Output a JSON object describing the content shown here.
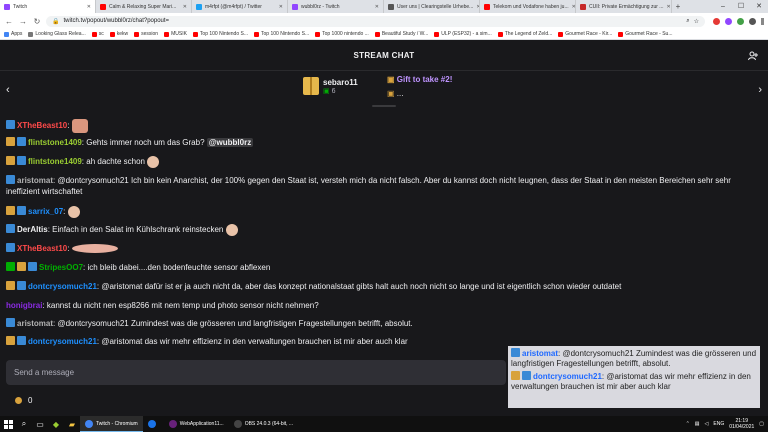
{
  "browser": {
    "tabs": [
      {
        "title": "Twitch",
        "color": "#9146ff",
        "active": true
      },
      {
        "title": "Calm & Relaxing Super Mari...",
        "color": "#ff0000"
      },
      {
        "title": "m4rfpt (@m4rfpt) / Twitter",
        "color": "#1da1f2"
      },
      {
        "title": "wubbl0rz - Twitch",
        "color": "#9146ff"
      },
      {
        "title": "User uns | Clearingstelle Urhebe...",
        "color": "#555555"
      },
      {
        "title": "Telekom und Vodafone haben ju...",
        "color": "#ff0000"
      },
      {
        "title": "CUII: Private Ermächtigung zur ...",
        "color": "#c62828"
      }
    ],
    "url": "twitch.tv/popout/wubbl0rz/chat?popout=",
    "bookmarks": [
      {
        "label": "Apps",
        "color": "#4285f4"
      },
      {
        "label": "Looking Glass Relea...",
        "color": "#777777"
      },
      {
        "label": "sc",
        "color": "#ff0000"
      },
      {
        "label": "kekw",
        "color": "#ff0000"
      },
      {
        "label": "session",
        "color": "#ff0000"
      },
      {
        "label": "MUSIK",
        "color": "#ff0000"
      },
      {
        "label": "Top 100 Nintendo S...",
        "color": "#ff0000"
      },
      {
        "label": "Top 100 Nintendo S...",
        "color": "#ff0000"
      },
      {
        "label": "Top 1000 nintendo ...",
        "color": "#ff0000"
      },
      {
        "label": "Beautiful Study / W...",
        "color": "#ff0000"
      },
      {
        "label": "ULP (ESP32) - a sim...",
        "color": "#ff0000"
      },
      {
        "label": "The Legend of Zeld...",
        "color": "#ff0000"
      },
      {
        "label": "Gourmet Race - Kir...",
        "color": "#ff0000"
      },
      {
        "label": "Gourmet Race - Su...",
        "color": "#ff0000"
      }
    ]
  },
  "chat": {
    "header_title": "STREAM CHAT",
    "gifter": {
      "name": "sebaro11",
      "count": "6"
    },
    "gift_cta": "Gift to take #2!",
    "gift_cta_sub": "...",
    "messages": [
      {
        "badges": [
          "sub"
        ],
        "name": "XTheBeast10",
        "color": "#ff4a4a",
        "text": "",
        "emote": "wide"
      },
      {
        "badges": [
          "gift",
          "sub"
        ],
        "name": "flintstone1409",
        "color": "#9acd32",
        "text": "Gehts immer noch um das Grab? ",
        "mention": "@wubbl0rz"
      },
      {
        "badges": [
          "gift",
          "sub"
        ],
        "name": "flintstone1409",
        "color": "#9acd32",
        "text": "ah dachte schon ",
        "emote": "small"
      },
      {
        "badges": [
          "sub"
        ],
        "name": "aristomat",
        "color": "#b3b3b3",
        "text": "@dontcrysomuch21 Ich bin kein Anarchist, der 100% gegen den Staat ist, versteh mich da nicht falsch. Aber du kannst doch nicht leugnen, dass der Staat in den meisten Bereichen sehr sehr ineffizient wirtschaftet"
      },
      {
        "badges": [
          "gift",
          "sub"
        ],
        "name": "sarrix_07",
        "color": "#1e90ff",
        "text": "",
        "emote": "small"
      },
      {
        "badges": [
          "sub"
        ],
        "name": "DerAltis",
        "color": "#efeff1",
        "text": "Einfach in den Salat im Kühlschrank reinstecken ",
        "emote": "small"
      },
      {
        "badges": [
          "sub"
        ],
        "name": "XTheBeast10",
        "color": "#ff4a4a",
        "text": "",
        "emote": "long"
      },
      {
        "badges": [
          "mod",
          "gift",
          "sub"
        ],
        "name": "StripesOO7",
        "color": "#00b000",
        "text": "ich bleib dabei....den bodenfeuchte sensor abflexen"
      },
      {
        "badges": [
          "gift",
          "sub"
        ],
        "name": "dontcrysomuch21",
        "color": "#1e90ff",
        "text": "@aristomat dafür ist er ja auch nicht da, aber das konzept nationalstaat gibts halt auch noch nicht so lange und ist eigentlich schon wieder outdatet"
      },
      {
        "badges": [],
        "name": "honigbrai",
        "color": "#8a2be2",
        "text": "kannst du nicht nen esp8266 mit nem temp und photo sensor nicht nehmen?"
      },
      {
        "badges": [
          "sub"
        ],
        "name": "aristomat",
        "color": "#b3b3b3",
        "text": "@dontcrysomuch21 Zumindest was die grösseren und langfristigen Fragestellungen betrifft, absolut."
      },
      {
        "badges": [
          "gift",
          "sub"
        ],
        "name": "dontcrysomuch21",
        "color": "#1e90ff",
        "text": "@aristomat das wir mehr effizienz in den verwaltungen brauchen ist mir aber auch klar"
      }
    ],
    "input_placeholder": "Send a message",
    "points": "0"
  },
  "overlay": {
    "msg1_name": "aristomat",
    "msg1_text": "@dontcrysomuch21 Zumindest was die grösseren und langfristigen Fragestellungen betrifft, absolut.",
    "msg2_name": "dontcrysomuch21",
    "msg2_text": "@aristomat das wir mehr effizienz in den verwaltungen brauchen ist mir aber auch klar"
  },
  "taskbar": {
    "apps": [
      {
        "label": "Twitch - Chromium",
        "color": "#4285f4",
        "active": true
      },
      {
        "label": "",
        "color": "#1a73e8",
        "active": false
      },
      {
        "label": "WebApplication11...",
        "color": "#68217a",
        "active": false
      },
      {
        "label": "OBS 24.0.3 (64-bit, ...",
        "color": "#444444",
        "active": false
      }
    ],
    "lang": "ENG",
    "time": "21:19",
    "date": "01/04/2021"
  }
}
